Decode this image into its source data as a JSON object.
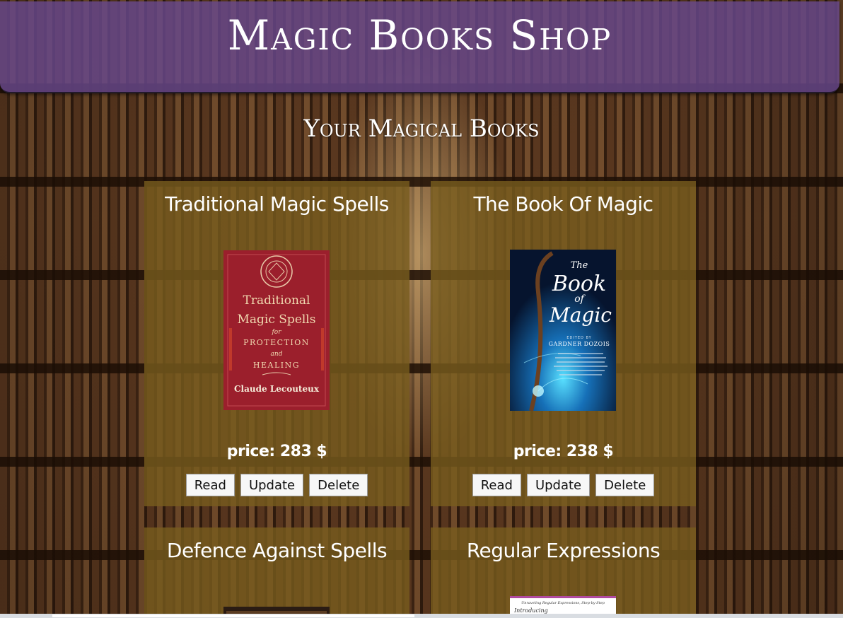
{
  "header": {
    "title": "Magic Books Shop"
  },
  "section": {
    "title": "Your Magical Books"
  },
  "books": [
    {
      "title": "Traditional Magic Spells",
      "price": "price: 283 $",
      "cover": {
        "line1": "Traditional",
        "line2": "Magic Spells",
        "line3": "for",
        "line4": "PROTECTION",
        "line5": "and",
        "line6": "HEALING",
        "author": "Claude Lecouteux"
      },
      "buttons": {
        "read": "Read",
        "update": "Update",
        "delete": "Delete"
      }
    },
    {
      "title": "The Book Of Magic",
      "price": "price: 238 $",
      "cover": {
        "line1": "The",
        "line2": "Book",
        "line3": "of",
        "line4": "Magic",
        "editor": "EDITED BY",
        "author": "GARDNER DOZOIS"
      },
      "buttons": {
        "read": "Read",
        "update": "Update",
        "delete": "Delete"
      }
    },
    {
      "title": "Defence Against Spells"
    },
    {
      "title": "Regular Expressions",
      "cover": {
        "tagline": "Unraveling Regular Expressions, Step-by-Step",
        "line1": "Introducing"
      }
    }
  ],
  "colors": {
    "header_bg": "#68488c",
    "card_bg": "#785c1e",
    "button_bg": "#f7f7f7",
    "text": "#ffffff"
  }
}
